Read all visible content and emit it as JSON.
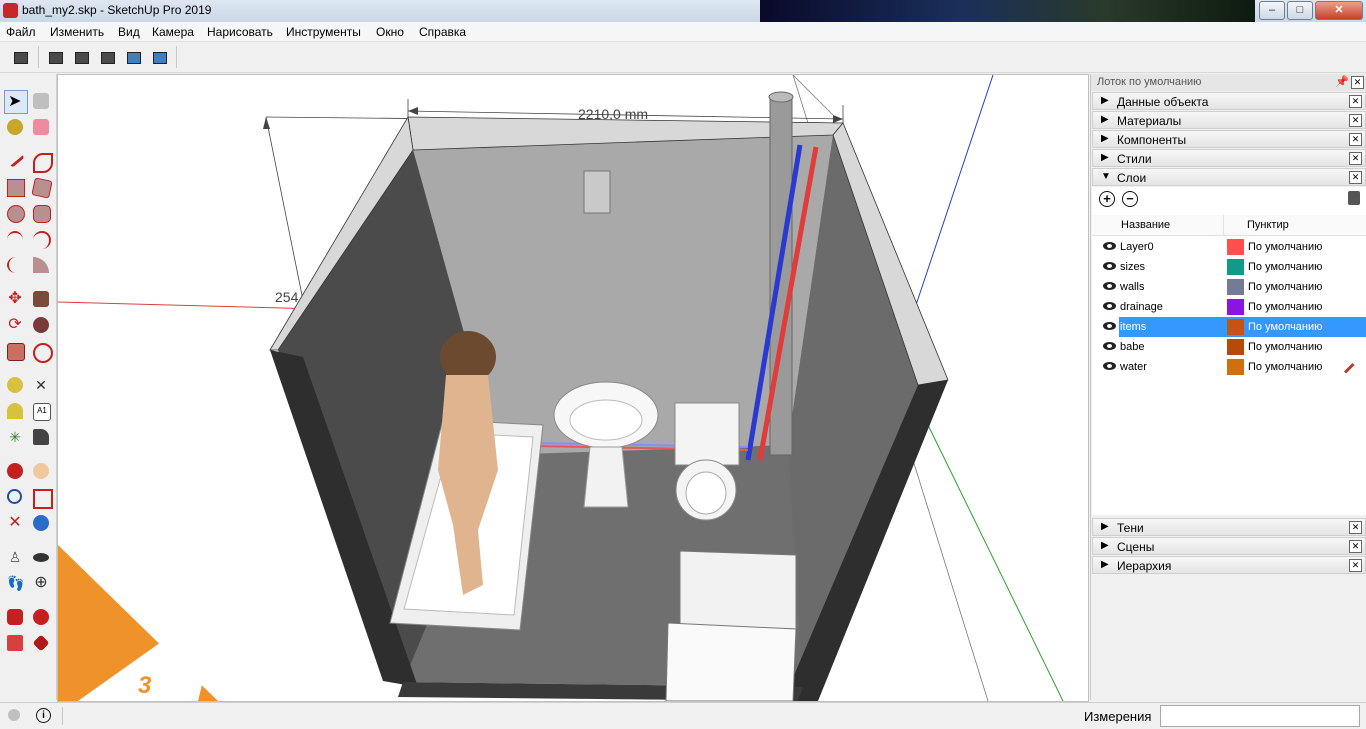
{
  "window": {
    "title": "bath_my2.skp - SketchUp Pro 2019",
    "minimize": "–",
    "maximize": "□",
    "close": "✕"
  },
  "menu": [
    "Файл",
    "Изменить",
    "Вид",
    "Камера",
    "Нарисовать",
    "Инструменты",
    "Окно",
    "Справка"
  ],
  "viewport": {
    "dimension_top": "2210,0 mm",
    "dimension_side": "254",
    "badge_number": "3"
  },
  "tray": {
    "title": "Лоток по умолчанию",
    "panels_top": [
      "Данные объекта",
      "Материалы",
      "Компоненты",
      "Стили"
    ],
    "layers_panel": "Слои",
    "columns": {
      "name": "Название",
      "dash": "Пунктир"
    },
    "layers": [
      {
        "name": "Layer0",
        "color": "#ff4f4f",
        "dash": "По умолчанию"
      },
      {
        "name": "sizes",
        "color": "#139a86",
        "dash": "По умолчанию"
      },
      {
        "name": "walls",
        "color": "#757b96",
        "dash": "По умолчанию"
      },
      {
        "name": "drainage",
        "color": "#8b14e0",
        "dash": "По умолчанию"
      },
      {
        "name": "items",
        "color": "#c65310",
        "dash": "По умолчанию"
      },
      {
        "name": "babe",
        "color": "#b84a08",
        "dash": "По умолчанию"
      },
      {
        "name": "water",
        "color": "#d0700c",
        "dash": "По умолчанию"
      }
    ],
    "selected_layer": "items",
    "panels_bottom": [
      "Тени",
      "Сцены",
      "Иерархия"
    ]
  },
  "status": {
    "measure_label": "Измерения"
  }
}
